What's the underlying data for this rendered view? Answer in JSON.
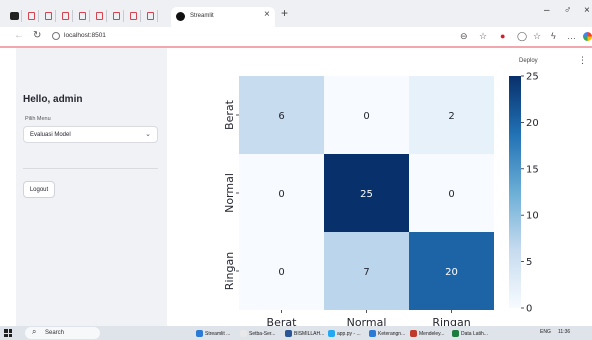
{
  "browser": {
    "active_tab_title": "Streamlit",
    "url": "localhost:8501"
  },
  "sidebar": {
    "greeting": "Hello, admin",
    "menu_label": "Pilih Menu",
    "menu_value": "Evaluasi Model",
    "logout_label": "Logout"
  },
  "header": {
    "deploy_label": "Deploy",
    "menu_glyph": "⋮"
  },
  "chart_data": {
    "type": "heatmap",
    "title": "",
    "xlabel": "",
    "ylabel": "",
    "x_categories": [
      "Berat",
      "Normal",
      "Ringan"
    ],
    "y_categories": [
      "Berat",
      "Normal",
      "Ringan"
    ],
    "values": [
      [
        6,
        0,
        2
      ],
      [
        0,
        25,
        0
      ],
      [
        0,
        7,
        20
      ]
    ],
    "colormap": "Blues",
    "colorbar": {
      "min": 0,
      "max": 25,
      "ticks": [
        "0",
        "5",
        "10",
        "15",
        "20",
        "25"
      ]
    },
    "annotated": true,
    "grid": false
  },
  "taskbar": {
    "search_label": "Search",
    "apps": [
      "Streamlit ...",
      "Setba-Ser...",
      "BISMILLAH...",
      "app.py - ...",
      "Keterangn...",
      "Mendeley...",
      "Data Latih..."
    ],
    "language": "ENG",
    "time": "11:36"
  },
  "colors": {
    "sidebar_bg": "#f0f2f6",
    "accent": "#ff4b4b",
    "pdf_icon": "#d6434f"
  }
}
